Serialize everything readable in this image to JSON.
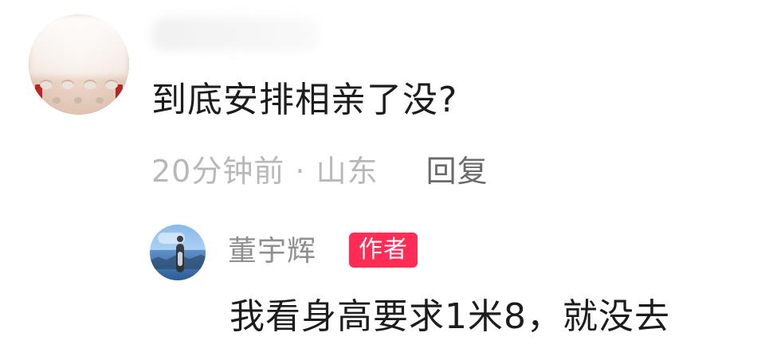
{
  "comment": {
    "text": "到底安排相亲了没?",
    "time_location": "20分钟前 · 山东",
    "reply_label": "回复",
    "avatar_icon": "avatar-food-photo-icon",
    "username_obscured": true
  },
  "reply": {
    "author_name": "董宇辉",
    "badge_label": "作者",
    "text": "我看身高要求1米8，就没去",
    "avatar_icon": "avatar-person-by-lake-icon",
    "badge_color": "#ff2d55"
  },
  "colors": {
    "text_primary": "#1c1c1c",
    "text_secondary": "#b8b8b8",
    "text_muted": "#8f8f8f",
    "reply_link": "#6a6a6a"
  }
}
